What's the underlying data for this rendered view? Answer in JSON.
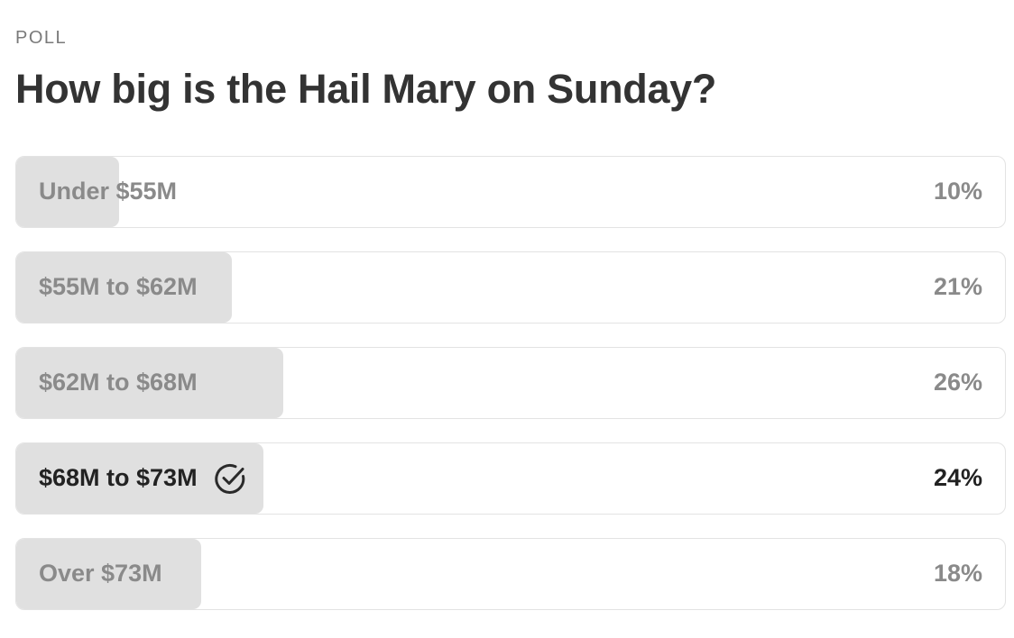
{
  "poll": {
    "label": "POLL",
    "question": "How big is the Hail Mary on Sunday?",
    "options": [
      {
        "label": "Under $55M",
        "percent_text": "10%",
        "percent": 10,
        "selected": false
      },
      {
        "label": "$55M to $62M",
        "percent_text": "21%",
        "percent": 21,
        "selected": false
      },
      {
        "label": "$62M to $68M",
        "percent_text": "26%",
        "percent": 26,
        "selected": false
      },
      {
        "label": "$68M to $73M",
        "percent_text": "24%",
        "percent": 24,
        "selected": true,
        "icon": "check-circle-icon"
      },
      {
        "label": "Over $73M",
        "percent_text": "18%",
        "percent": 18,
        "selected": false
      }
    ]
  },
  "colors": {
    "fill": "#e0e0e0",
    "border": "#e3e3e3",
    "text_muted": "#8a8a8a",
    "text_selected": "#222222"
  }
}
